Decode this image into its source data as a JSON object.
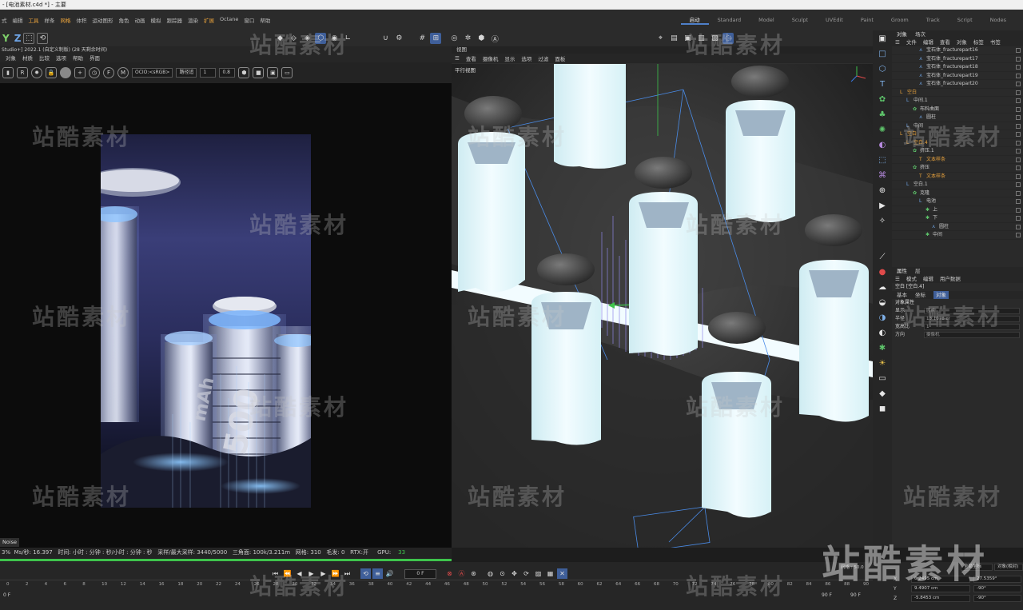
{
  "window": {
    "title": "- [电池素材.c4d *] - 主要"
  },
  "menu": {
    "items": [
      "式",
      "编辑",
      "工具",
      "样条",
      "网格",
      "体积",
      "运动图形",
      "角色",
      "动画",
      "模拟",
      "跟踪器",
      "渲染",
      "扩展",
      "Octane",
      "窗口",
      "帮助"
    ],
    "highlighted": [
      "工具",
      "网格",
      "扩展"
    ]
  },
  "layouts": {
    "items": [
      "启动",
      "Standard",
      "Model",
      "Sculpt",
      "UVEdit",
      "Paint",
      "Groom",
      "Track",
      "Script",
      "Nodes"
    ],
    "active": "启动"
  },
  "toolbar": {
    "axis_y": "Y",
    "axis_z": "Z"
  },
  "live_viewer": {
    "info": "Studio+] 2022.1 (自定义制版) (28 天剩余时间)",
    "menu": [
      "对象",
      "材质",
      "比较",
      "选项",
      "帮助",
      "界面"
    ],
    "ocio": "OCIO:<sRGB>",
    "tonemap": "路径追",
    "value1": "1",
    "value2": "0.8",
    "poster_text_1": "6500",
    "poster_text_2": "mAh"
  },
  "viewport": {
    "title": "视图",
    "menu": [
      "查看",
      "摄像机",
      "显示",
      "选项",
      "过滤",
      "面板"
    ],
    "label": "平行视图"
  },
  "status": {
    "noise_tab": "Noise",
    "percent": "3%",
    "ms": "Ms/秒: 16.397",
    "time": "时间: 小时 : 分钟 : 秒/小时 : 分钟 : 秒",
    "samples": "采样/最大采样: 3440/5000",
    "triangles": "三角面: 100k/3.211m",
    "meshes": "网格: 310",
    "hair": "毛发: 0",
    "rtx": "RTX:开",
    "gpu_label": "GPU:",
    "gpu_value": "33",
    "progress": 1.0
  },
  "object_manager": {
    "tabs": [
      "对象",
      "场次"
    ],
    "menu": [
      "文件",
      "编辑",
      "查看",
      "对象",
      "标签",
      "书签"
    ],
    "rows": [
      {
        "label": "宝石体_fracturepart16",
        "indent": 3,
        "type": "frac"
      },
      {
        "label": "宝石体_fracturepart17",
        "indent": 3,
        "type": "frac"
      },
      {
        "label": "宝石体_fracturepart18",
        "indent": 3,
        "type": "frac"
      },
      {
        "label": "宝石体_fracturepart19",
        "indent": 3,
        "type": "frac"
      },
      {
        "label": "宝石体_fracturepart20",
        "indent": 3,
        "type": "frac"
      },
      {
        "label": "空白",
        "indent": 0,
        "type": "null-orange"
      },
      {
        "label": "中间.1",
        "indent": 1,
        "type": "null"
      },
      {
        "label": "布料曲面",
        "indent": 2,
        "type": "cloth"
      },
      {
        "label": "圆柱",
        "indent": 3,
        "type": "obj"
      },
      {
        "label": "中间",
        "indent": 1,
        "type": "null"
      },
      {
        "label": "空白",
        "indent": 0,
        "type": "null-orange"
      },
      {
        "label": "空白.4",
        "indent": 1,
        "type": "null-orange"
      },
      {
        "label": "挤压.1",
        "indent": 2,
        "type": "extrude"
      },
      {
        "label": "文本样条",
        "indent": 3,
        "type": "text-orange"
      },
      {
        "label": "挤压",
        "indent": 2,
        "type": "extrude"
      },
      {
        "label": "文本样条",
        "indent": 3,
        "type": "text-orange"
      },
      {
        "label": "空白.1",
        "indent": 1,
        "type": "null"
      },
      {
        "label": "克隆",
        "indent": 2,
        "type": "clone"
      },
      {
        "label": "电池",
        "indent": 3,
        "type": "null"
      },
      {
        "label": "上",
        "indent": 4,
        "type": "sym"
      },
      {
        "label": "下",
        "indent": 4,
        "type": "sym"
      },
      {
        "label": "圆柱",
        "indent": 5,
        "type": "obj"
      },
      {
        "label": "中间",
        "indent": 4,
        "type": "sym"
      }
    ]
  },
  "attributes": {
    "tabs": [
      "属性",
      "层"
    ],
    "menu": [
      "模式",
      "编辑",
      "用户数据"
    ],
    "object_name": "空白 [空白.4]",
    "subtabs": [
      "基本",
      "坐标",
      "对象"
    ],
    "section": "对象属性",
    "fields": [
      {
        "label": "显示",
        "value": "圆点"
      },
      {
        "label": "半径",
        "value": "13.1078 cr"
      },
      {
        "label": "宽高比",
        "value": "1"
      },
      {
        "label": "方向",
        "value": "摄像机"
      }
    ]
  },
  "timeline": {
    "frame": "0 F",
    "start": "0 F",
    "end_a": "90 F",
    "end_b": "90 F",
    "ticks": [
      "0",
      "2",
      "4",
      "6",
      "8",
      "10",
      "12",
      "14",
      "16",
      "18",
      "20",
      "22",
      "24",
      "26",
      "28",
      "30",
      "32",
      "34",
      "36",
      "38",
      "40",
      "42",
      "44",
      "46",
      "48",
      "50",
      "52",
      "54",
      "56",
      "58",
      "60",
      "62",
      "64",
      "66",
      "68",
      "70",
      "72",
      "74",
      "76",
      "78",
      "80",
      "82",
      "84",
      "86",
      "88",
      "90"
    ]
  },
  "coordinates": {
    "header_left": "网格 : 50.0",
    "header_mid": "全局坐标",
    "header_right": "对象(相对)",
    "x": "6.2495 cm",
    "y": "9.4907 cm",
    "z": "-5.8453 cm",
    "h": "27.5359°",
    "p": "-90°",
    "b": "-90°"
  },
  "watermark": {
    "text": "站酷素材"
  },
  "colors": {
    "accent": "#4e7fc9",
    "green": "#3ec44c",
    "orange": "#e8a23c",
    "bg": "#1d1d1d"
  }
}
